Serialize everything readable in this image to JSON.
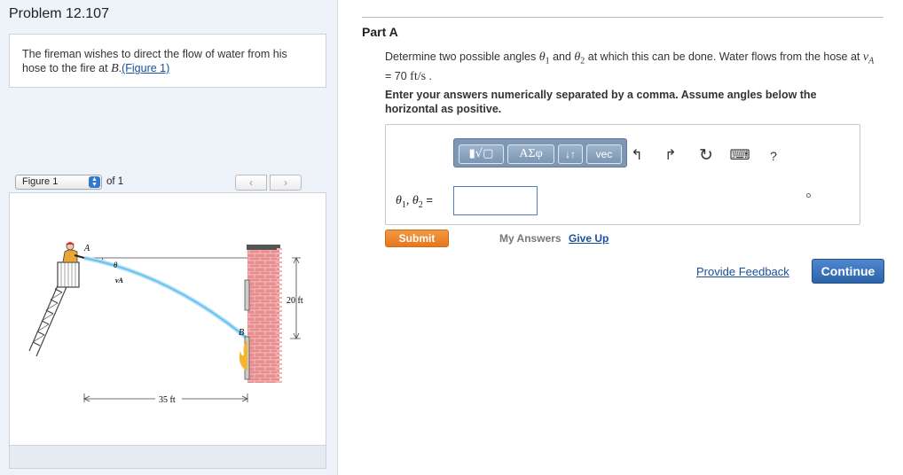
{
  "problem": {
    "title": "Problem 12.107",
    "text_before": "The fireman wishes to direct the flow of water from his hose to the fire at ",
    "point": "B",
    "text_period": ".",
    "figure_link": "(Figure 1)"
  },
  "figure_nav": {
    "selected": "Figure 1",
    "of_label": "of 1",
    "prev_icon": "‹",
    "next_icon": "›"
  },
  "figure": {
    "label_A": "A",
    "label_B": "B",
    "label_theta": "θ",
    "label_vA": "vA",
    "height_label": "20 ft",
    "distance_label": "35 ft",
    "colors": {
      "water": "#7cc8ef",
      "brick": "#e6888a",
      "fire": "#f2b233"
    }
  },
  "part": {
    "title": "Part A",
    "question_pre": "Determine two possible angles ",
    "theta1": "θ",
    "sub1": "1",
    "and": " and ",
    "theta2": "θ",
    "sub2": "2",
    "question_mid": " at which this can be done. Water flows from the hose at ",
    "v_sym": "v",
    "v_sub": "A",
    "v_eq": " = 70 ",
    "v_unit": "ft/s",
    "question_end": " .",
    "instructions": "Enter your answers numerically separated by a comma. Assume angles below the horizontal as positive."
  },
  "toolbar": {
    "templates_label": "▮√▢",
    "greek_label": "ΑΣφ",
    "updown_label": "↓↑",
    "vec_label": "vec",
    "undo_icon": "↰",
    "redo_icon": "↱",
    "reset_icon": "↻",
    "keyboard_icon": "⌨",
    "help_label": "?"
  },
  "answer": {
    "label_theta1": "θ",
    "label_sub1": "1",
    "label_comma": ", ",
    "label_theta2": "θ",
    "label_sub2": "2",
    "label_eq": " =",
    "value": ""
  },
  "actions": {
    "submit": "Submit",
    "my_answers": "My Answers",
    "give_up": "Give Up",
    "feedback": "Provide Feedback",
    "continue": "Continue"
  }
}
